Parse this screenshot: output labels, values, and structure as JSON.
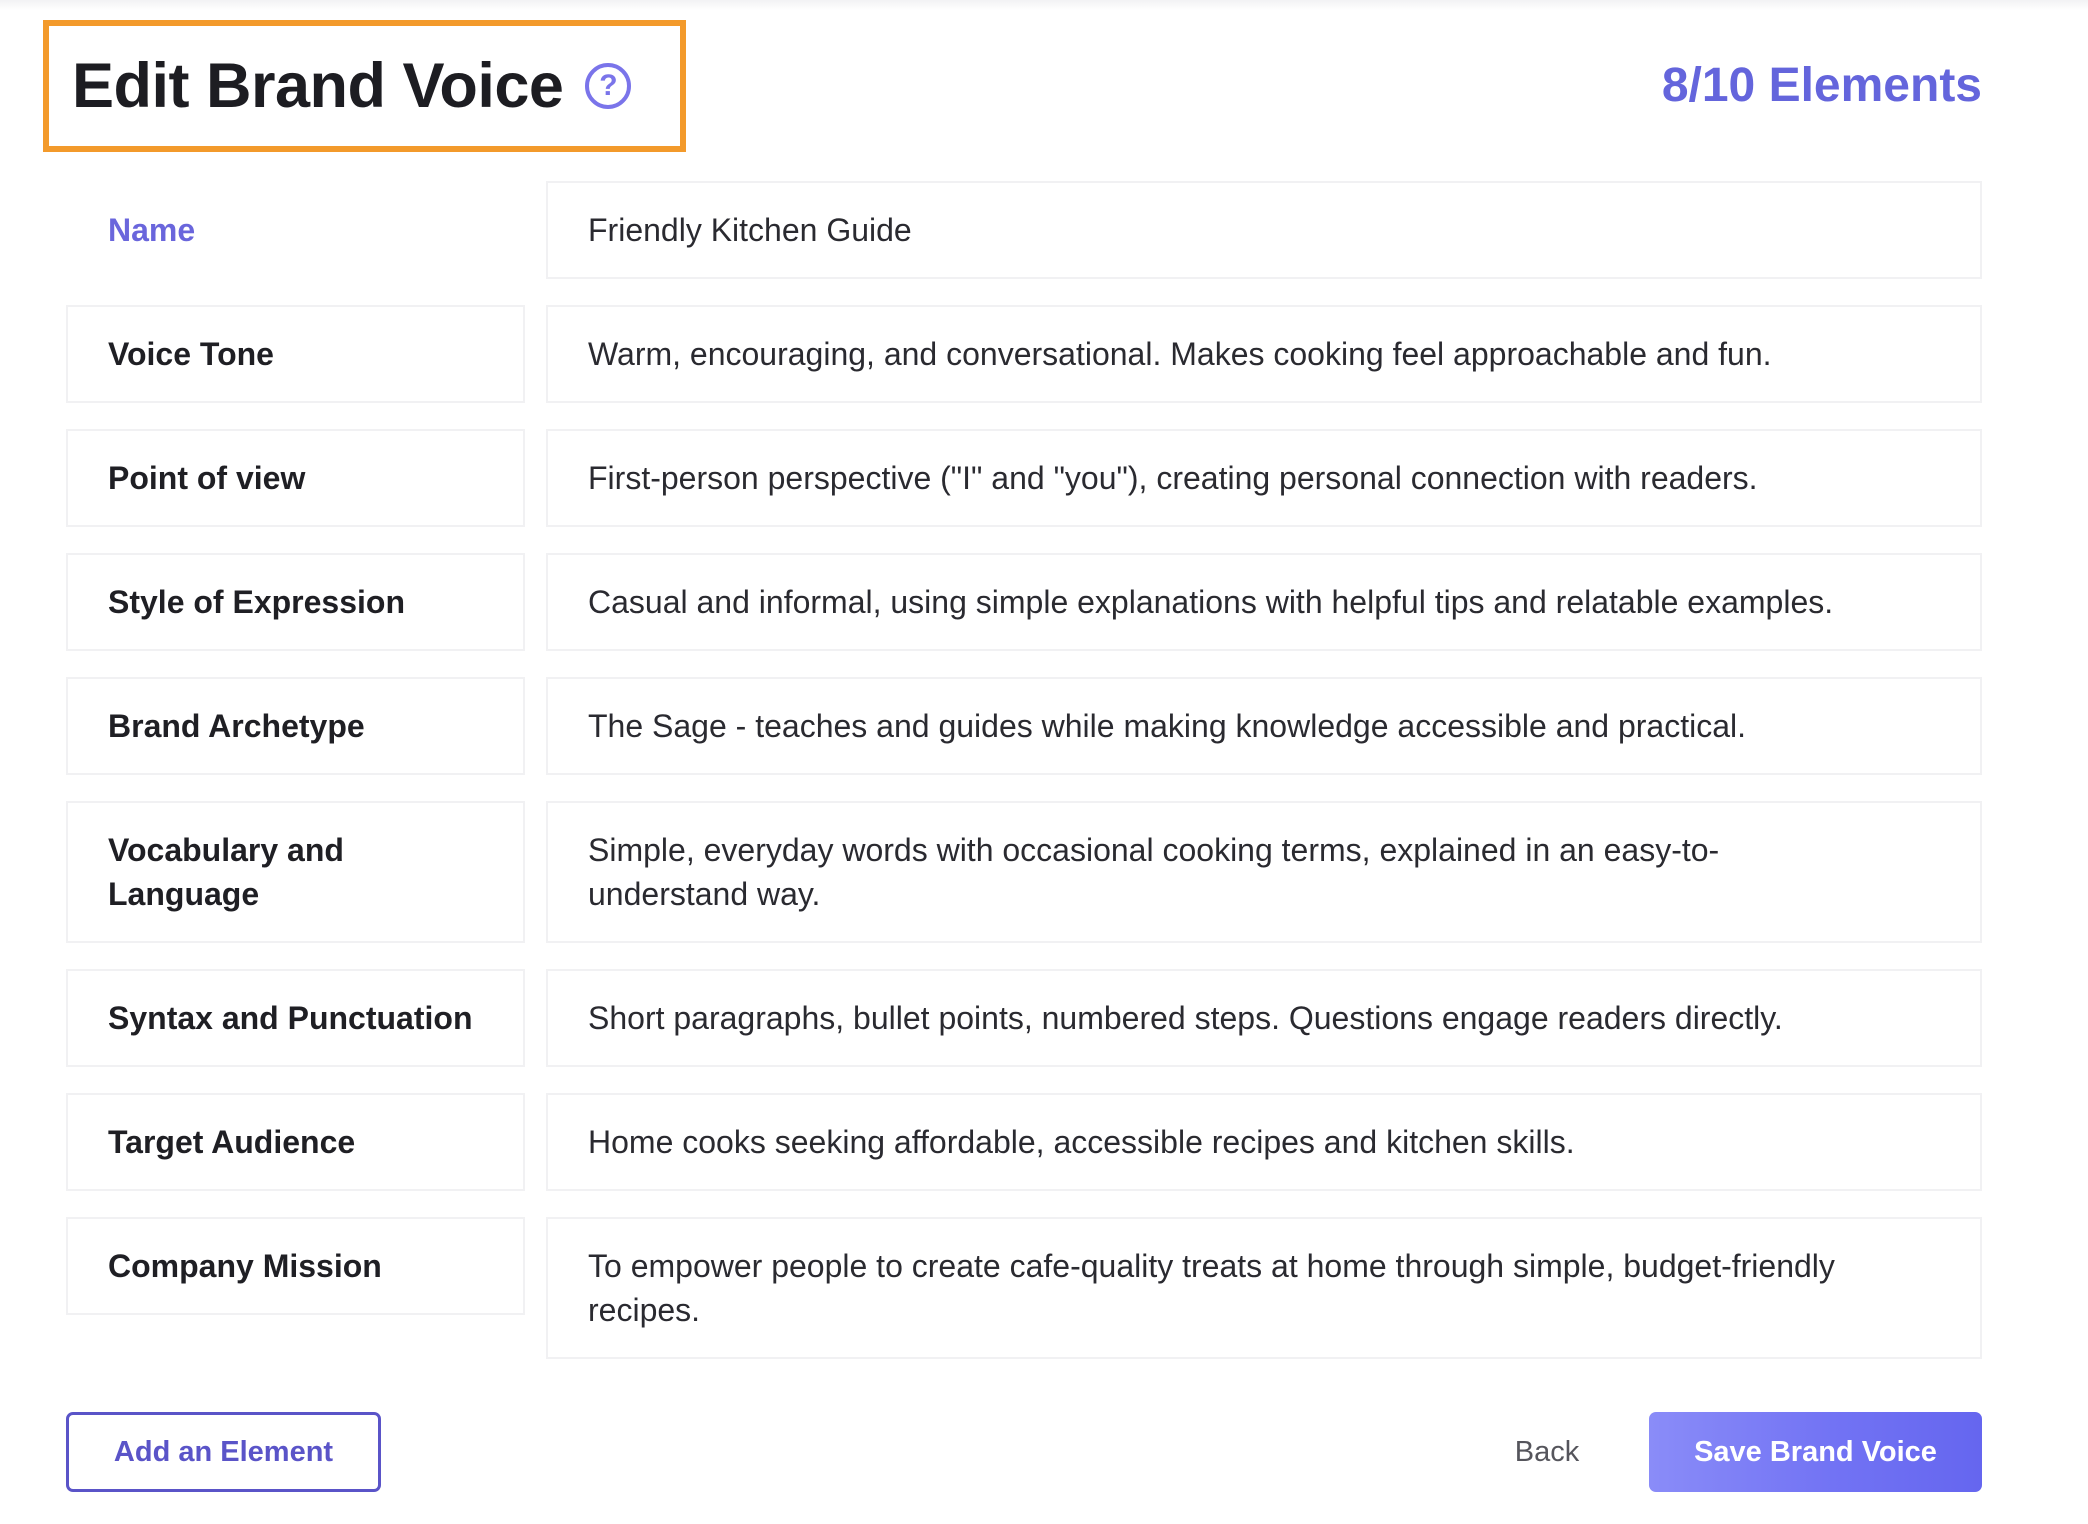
{
  "header": {
    "title": "Edit Brand Voice",
    "help_icon": "question-circle-icon",
    "counter": "8/10 Elements"
  },
  "name_field": {
    "label": "Name",
    "value": "Friendly Kitchen Guide"
  },
  "elements": [
    {
      "label": "Voice Tone",
      "value": "Warm, encouraging, and conversational. Makes cooking feel approachable and fun."
    },
    {
      "label": "Point of view",
      "value": "First-person perspective (\"I\" and \"you\"), creating personal connection with readers."
    },
    {
      "label": "Style of Expression",
      "value": "Casual and informal, using simple explanations with helpful tips and relatable examples."
    },
    {
      "label": "Brand Archetype",
      "value": "The Sage - teaches and guides while making knowledge accessible and practical."
    },
    {
      "label": "Vocabulary and Language",
      "value": "Simple, everyday words with occasional cooking terms, explained in an easy-to-understand way."
    },
    {
      "label": "Syntax and Punctuation",
      "value": "Short paragraphs, bullet points, numbered steps. Questions engage readers directly."
    },
    {
      "label": "Target Audience",
      "value": "Home cooks seeking affordable, accessible recipes and kitchen skills."
    },
    {
      "label": "Company Mission",
      "value": "To empower people to create cafe-quality treats at home through simple, budget-friendly recipes."
    }
  ],
  "footer": {
    "add_label": "Add an Element",
    "back_label": "Back",
    "save_label": "Save Brand Voice"
  },
  "colors": {
    "accent": "#6465dc",
    "highlight_border": "#f39a2b",
    "save_gradient_start": "#8a8cf8",
    "save_gradient_end": "#6566ef"
  }
}
